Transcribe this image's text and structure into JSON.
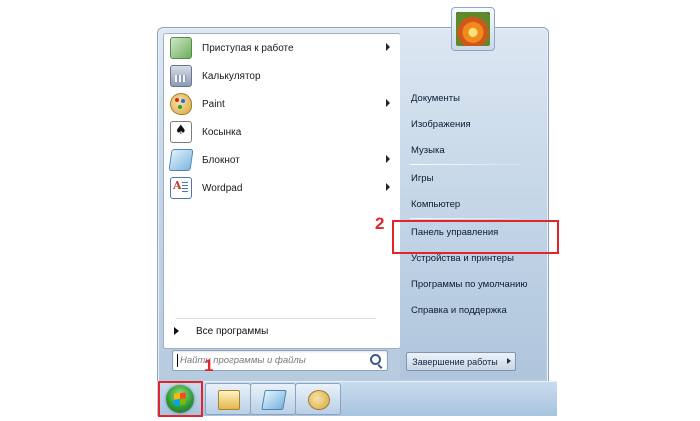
{
  "start_menu": {
    "programs": [
      {
        "label": "Приступая к работе",
        "icon": "getting-started-icon",
        "has_submenu": true
      },
      {
        "label": "Калькулятор",
        "icon": "calculator-icon",
        "has_submenu": false
      },
      {
        "label": "Paint",
        "icon": "paint-icon",
        "has_submenu": true
      },
      {
        "label": "Косынка",
        "icon": "solitaire-icon",
        "has_submenu": false
      },
      {
        "label": "Блокнот",
        "icon": "notepad-icon",
        "has_submenu": true
      },
      {
        "label": "Wordpad",
        "icon": "wordpad-icon",
        "has_submenu": true
      }
    ],
    "all_programs_label": "Все программы",
    "search": {
      "placeholder": "Найти программы и файлы",
      "value": ""
    },
    "right_links": [
      {
        "label": "Документы"
      },
      {
        "label": "Изображения"
      },
      {
        "label": "Музыка"
      },
      {
        "label": "Игры"
      },
      {
        "label": "Компьютер"
      },
      {
        "label": "Панель управления"
      },
      {
        "label": "Устройства и принтеры"
      },
      {
        "label": "Программы по умолчанию"
      },
      {
        "label": "Справка и поддержка"
      }
    ],
    "shutdown_label": "Завершение работы"
  },
  "taskbar": {
    "pinned": [
      {
        "icon": "file-explorer-icon"
      },
      {
        "icon": "notepad-icon"
      },
      {
        "icon": "paint-icon"
      }
    ]
  },
  "annotations": [
    {
      "label": "1",
      "target": "start-button"
    },
    {
      "label": "2",
      "target": "control-panel-link"
    }
  ],
  "colors": {
    "annotation": "#e1252a",
    "link_text": "#0b1c33"
  }
}
